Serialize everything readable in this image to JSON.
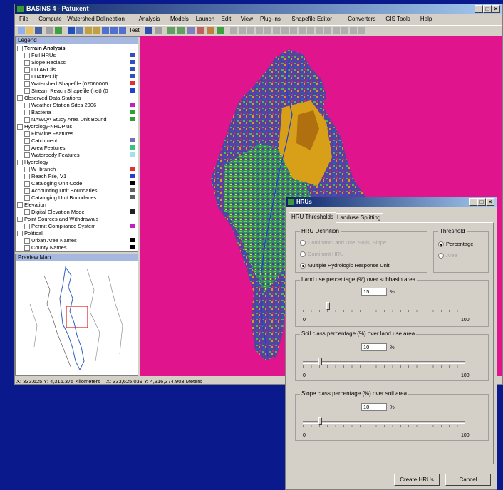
{
  "window": {
    "title": "BASINS 4 - Patuxent"
  },
  "menu": [
    "File",
    "Compute",
    "Watershed Delineation",
    "Analysis",
    "Models",
    "Launch",
    "Edit",
    "View",
    "Plug-ins",
    "Shapefile Editor",
    "Converters",
    "GIS Tools",
    "Help"
  ],
  "toolbar": {
    "test_label": "Test"
  },
  "legend": {
    "title": "Legend",
    "rows": [
      {
        "text": "Terrain Analysis",
        "level": 0,
        "bold": true
      },
      {
        "text": "Full HRUs",
        "level": 1
      },
      {
        "text": "Slope Reclass",
        "level": 1
      },
      {
        "text": "LU ARClis",
        "level": 1
      },
      {
        "text": "LUAfterClip",
        "level": 1
      },
      {
        "text": "Watershed Shapefile (02060006",
        "level": 1
      },
      {
        "text": "Stream Reach Shapefile (net) (0",
        "level": 1
      },
      {
        "text": "Observed Data Stations",
        "level": 0
      },
      {
        "text": "Weather Station Sites 2006",
        "level": 1
      },
      {
        "text": "Bacteria",
        "level": 1
      },
      {
        "text": "NAWQA Study Area Unit Bound",
        "level": 1
      },
      {
        "text": "Hydrology-NHDPlus",
        "level": 0
      },
      {
        "text": "Flowline Features",
        "level": 1
      },
      {
        "text": "Catchment",
        "level": 1
      },
      {
        "text": "Area Features",
        "level": 1
      },
      {
        "text": "Waterbody Features",
        "level": 1
      },
      {
        "text": "Hydrology",
        "level": 0
      },
      {
        "text": "W_branch",
        "level": 1
      },
      {
        "text": "Reach File, V1",
        "level": 1
      },
      {
        "text": "Cataloging Unit Code",
        "level": 1
      },
      {
        "text": "Accounting Unit Boundaries",
        "level": 1
      },
      {
        "text": "Cataloging Unit Boundaries",
        "level": 1
      },
      {
        "text": "Elevation",
        "level": 0
      },
      {
        "text": "Digital Elevation Model",
        "level": 1
      },
      {
        "text": "Point Sources and Withdrawals",
        "level": 0
      },
      {
        "text": "Permit Compliance System",
        "level": 1
      },
      {
        "text": "Political",
        "level": 0
      },
      {
        "text": "Urban Area Names",
        "level": 1
      },
      {
        "text": "County Names",
        "level": 1
      }
    ]
  },
  "preview": {
    "title": "Preview Map"
  },
  "status": {
    "coords_km": "X: 333.625 Y: 4,316.375 Kilometers",
    "coords_m": "X: 333,625.039 Y: 4,316,374.903 Meters"
  },
  "dialog": {
    "title": "HRUs",
    "tabs": [
      "HRU Thresholds",
      "Landuse Splitting"
    ],
    "definition": {
      "label": "HRU Definition",
      "options": [
        "Dominant Land Use, Soils, Slope",
        "Dominant HRU",
        "Multiple Hydrologic Response Unit"
      ],
      "selected": 2
    },
    "threshold": {
      "label": "Threshold",
      "options": [
        "Percentage",
        "Area"
      ],
      "selected": 0
    },
    "land": {
      "label": "Land use percentage (%) over subbasin area",
      "value": "15",
      "unit": "%",
      "min": "0",
      "max": "100",
      "fraction": 0.15
    },
    "soil": {
      "label": "Soil class percentage (%) over land use area",
      "value": "10",
      "unit": "%",
      "min": "0",
      "max": "100",
      "fraction": 0.1
    },
    "slope": {
      "label": "Slope class percentage (%) over soil area",
      "value": "10",
      "unit": "%",
      "min": "0",
      "max": "100",
      "fraction": 0.1
    },
    "create_label": "Create HRUs",
    "cancel_label": "Cancel"
  },
  "colors": {
    "map_background": "#e0148c",
    "desktop": "#0a1a8c",
    "titlebar": "#0a246a"
  }
}
